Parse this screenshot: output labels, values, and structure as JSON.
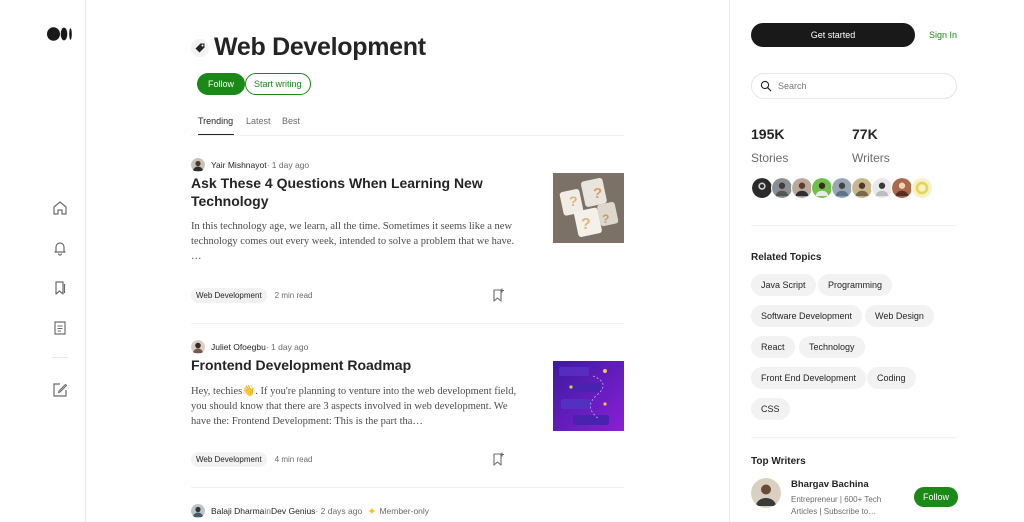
{
  "rail": {
    "icons": [
      "home-icon",
      "notifications-icon",
      "bookmarks-icon",
      "stories-icon",
      "write-icon"
    ]
  },
  "topic": {
    "title": "Web Development",
    "follow_label": "Follow",
    "write_label": "Start writing"
  },
  "tabs": [
    {
      "label": "Trending",
      "active": true
    },
    {
      "label": "Latest",
      "active": false
    },
    {
      "label": "Best",
      "active": false
    }
  ],
  "articles": [
    {
      "author": "Yair Mishnayot",
      "meta": " · 1 day ago",
      "title": "Ask These 4 Questions When Learning New Technology",
      "excerpt": "In this technology age, we learn, all the time. Sometimes it seems like a new technology comes out every week, intended to solve a problem that we have. …",
      "tag": "Web Development",
      "read_time": "2 min read"
    },
    {
      "author": "Juliet Ofoegbu",
      "meta": " · 1 day ago",
      "title": "Frontend Development Roadmap",
      "excerpt": "Hey, techies👋. If you're planning to venture into the web development field, you should know that there are 3 aspects involved in web development. We have the: Frontend Development: This is the part tha…",
      "tag": "Web Development",
      "read_time": "4 min read"
    },
    {
      "author": "Balaji Dharma",
      "in_label": " in ",
      "publication": "Dev Genius",
      "meta": " · 2 days ago",
      "member": "Member-only"
    }
  ],
  "sidebar": {
    "get_started": "Get started",
    "sign_in": "Sign In",
    "search_placeholder": "Search",
    "stories_count": "195K",
    "stories_label": "Stories",
    "writers_count": "77K",
    "writers_label": "Writers",
    "related_title": "Related Topics",
    "related_topics": [
      "Java Script",
      "Programming",
      "Software Development",
      "Web Design",
      "React",
      "Technology",
      "Front End Development",
      "Coding",
      "CSS"
    ],
    "top_writers_title": "Top Writers",
    "top_writer": {
      "name": "Bhargav Bachina",
      "bio": "Entrepreneur | 600+ Tech Articles | Subscribe to…",
      "follow_label": "Follow"
    }
  },
  "colors": {
    "accent_green": "#1a8917",
    "dark_button": "#191919",
    "pill_bg": "#f2f2f2",
    "member_star": "#ffc017"
  }
}
